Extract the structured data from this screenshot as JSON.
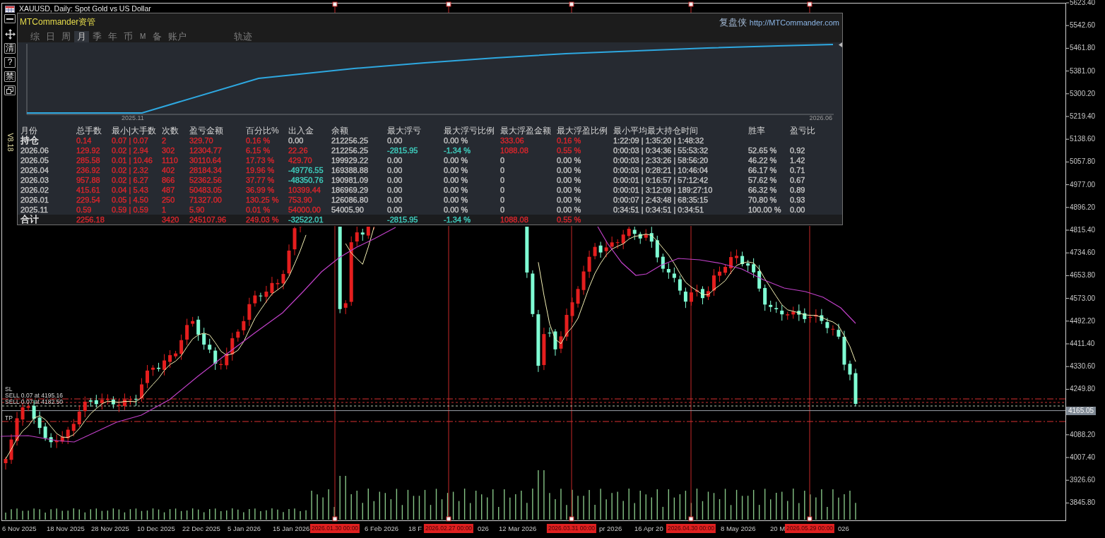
{
  "chart_window": {
    "title": "XAUUSD, Daily: Spot Gold vs US Dollar",
    "version": "V8.18"
  },
  "toolbar": [
    {
      "kind": "minimize"
    },
    {
      "kind": "move"
    },
    {
      "kind": "text",
      "label": "清"
    },
    {
      "kind": "text",
      "label": "?"
    },
    {
      "kind": "text",
      "label": "禁"
    },
    {
      "kind": "restore"
    }
  ],
  "panel": {
    "brand": "MTCommander资管",
    "brand_right": "复盘侠",
    "link": "http://MTCommander.com",
    "tabs": [
      {
        "label": "综",
        "selected": false,
        "disabled": false
      },
      {
        "label": "日",
        "selected": false,
        "disabled": false
      },
      {
        "label": "周",
        "selected": false,
        "disabled": false
      },
      {
        "label": "月",
        "selected": true,
        "disabled": false
      },
      {
        "label": "季",
        "selected": false,
        "disabled": false
      },
      {
        "label": "年",
        "selected": false,
        "disabled": false
      },
      {
        "label": "币",
        "selected": false,
        "disabled": false
      },
      {
        "label": "M",
        "selected": false,
        "disabled": true
      },
      {
        "label": "备",
        "selected": false,
        "disabled": false
      },
      {
        "label": "账户",
        "selected": false,
        "disabled": false
      },
      {
        "label": "轨迹",
        "selected": false,
        "disabled": false
      }
    ],
    "equity_chart": {
      "x_labels": [
        "2025.11",
        "2026.06"
      ]
    },
    "table": {
      "columns": [
        "月份",
        "总手数",
        "最小|大手数",
        "次数",
        "盈亏金额",
        "百分比%",
        "出入金",
        "余额",
        "最大浮亏",
        "最大浮亏比例",
        "最大浮盈金额",
        "最大浮盈比例",
        "最小平均最大持仓时间",
        "胜率",
        "盈亏比"
      ],
      "rows": [
        {
          "kind": "position",
          "cells": [
            {
              "text": "持仓",
              "color": "#e8e8e8"
            },
            {
              "text": "0.14",
              "color": "#d8262c"
            },
            {
              "text": "0.07 | 0.07",
              "color": "#d8262c"
            },
            {
              "text": "2",
              "color": "#d8262c"
            },
            {
              "text": "329.70",
              "color": "#d8262c"
            },
            {
              "text": "0.16 %",
              "color": "#d8262c"
            },
            {
              "text": "0.00",
              "color": "#c2c2c2"
            },
            {
              "text": "212256.25",
              "color": "#c2c2c2"
            },
            {
              "text": "0.00",
              "color": "#c2c2c2"
            },
            {
              "text": "0.00 %",
              "color": "#c2c2c2"
            },
            {
              "text": "333.06",
              "color": "#d8262c"
            },
            {
              "text": "0.16 %",
              "color": "#d8262c"
            },
            {
              "text": "1:22:09 | 1:35:20 | 1:48:32",
              "color": "#c2c2c2"
            }
          ]
        },
        {
          "kind": "month",
          "cells": [
            {
              "text": "2026.06",
              "color": "#c2c2c2"
            },
            {
              "text": "129.92",
              "color": "#d8262c"
            },
            {
              "text": "0.02 | 2.94",
              "color": "#d8262c"
            },
            {
              "text": "302",
              "color": "#d8262c"
            },
            {
              "text": "12304.77",
              "color": "#d8262c"
            },
            {
              "text": "6.15 %",
              "color": "#d8262c"
            },
            {
              "text": "22.26",
              "color": "#d8262c"
            },
            {
              "text": "212256.25",
              "color": "#c2c2c2"
            },
            {
              "text": "-2815.95",
              "color": "#3fcfbf"
            },
            {
              "text": "-1.34 %",
              "color": "#3fcfbf"
            },
            {
              "text": "1088.08",
              "color": "#d8262c"
            },
            {
              "text": "0.55 %",
              "color": "#d8262c"
            },
            {
              "text": "0:00:03 | 0:34:36 | 55:53:32",
              "color": "#c2c2c2"
            },
            {
              "text": "52.65 %",
              "color": "#c2c2c2"
            },
            {
              "text": "0.92",
              "color": "#c2c2c2"
            }
          ]
        },
        {
          "kind": "month",
          "cells": [
            {
              "text": "2026.05",
              "color": "#c2c2c2"
            },
            {
              "text": "285.58",
              "color": "#d8262c"
            },
            {
              "text": "0.01 | 10.46",
              "color": "#d8262c"
            },
            {
              "text": "1110",
              "color": "#d8262c"
            },
            {
              "text": "30110.64",
              "color": "#d8262c"
            },
            {
              "text": "17.73 %",
              "color": "#d8262c"
            },
            {
              "text": "429.70",
              "color": "#d8262c"
            },
            {
              "text": "199929.22",
              "color": "#c2c2c2"
            },
            {
              "text": "0.00",
              "color": "#c2c2c2"
            },
            {
              "text": "0.00 %",
              "color": "#c2c2c2"
            },
            {
              "text": "0",
              "color": "#c2c2c2"
            },
            {
              "text": "0.00 %",
              "color": "#c2c2c2"
            },
            {
              "text": "0:00:03 | 2:33:26 | 58:56:20",
              "color": "#c2c2c2"
            },
            {
              "text": "46.22 %",
              "color": "#c2c2c2"
            },
            {
              "text": "1.42",
              "color": "#c2c2c2"
            }
          ]
        },
        {
          "kind": "month",
          "cells": [
            {
              "text": "2026.04",
              "color": "#c2c2c2"
            },
            {
              "text": "236.92",
              "color": "#d8262c"
            },
            {
              "text": "0.02 | 2.32",
              "color": "#d8262c"
            },
            {
              "text": "402",
              "color": "#d8262c"
            },
            {
              "text": "28184.34",
              "color": "#d8262c"
            },
            {
              "text": "19.96 %",
              "color": "#d8262c"
            },
            {
              "text": "-49776.55",
              "color": "#3fcfbf"
            },
            {
              "text": "169388.88",
              "color": "#c2c2c2"
            },
            {
              "text": "0.00",
              "color": "#c2c2c2"
            },
            {
              "text": "0.00 %",
              "color": "#c2c2c2"
            },
            {
              "text": "0",
              "color": "#c2c2c2"
            },
            {
              "text": "0.00 %",
              "color": "#c2c2c2"
            },
            {
              "text": "0:00:03 | 0:28:21 | 10:46:04",
              "color": "#c2c2c2"
            },
            {
              "text": "66.17 %",
              "color": "#c2c2c2"
            },
            {
              "text": "0.71",
              "color": "#c2c2c2"
            }
          ]
        },
        {
          "kind": "month",
          "cells": [
            {
              "text": "2026.03",
              "color": "#c2c2c2"
            },
            {
              "text": "957.88",
              "color": "#d8262c"
            },
            {
              "text": "0.02 | 6.27",
              "color": "#d8262c"
            },
            {
              "text": "866",
              "color": "#d8262c"
            },
            {
              "text": "52362.56",
              "color": "#d8262c"
            },
            {
              "text": "37.77 %",
              "color": "#d8262c"
            },
            {
              "text": "-48350.76",
              "color": "#3fcfbf"
            },
            {
              "text": "190981.09",
              "color": "#c2c2c2"
            },
            {
              "text": "0.00",
              "color": "#c2c2c2"
            },
            {
              "text": "0.00 %",
              "color": "#c2c2c2"
            },
            {
              "text": "0",
              "color": "#c2c2c2"
            },
            {
              "text": "0.00 %",
              "color": "#c2c2c2"
            },
            {
              "text": "0:00:01 | 0:16:57 | 57:12:42",
              "color": "#c2c2c2"
            },
            {
              "text": "57.62 %",
              "color": "#c2c2c2"
            },
            {
              "text": "0.67",
              "color": "#c2c2c2"
            }
          ]
        },
        {
          "kind": "month",
          "cells": [
            {
              "text": "2026.02",
              "color": "#c2c2c2"
            },
            {
              "text": "415.61",
              "color": "#d8262c"
            },
            {
              "text": "0.04 | 5.43",
              "color": "#d8262c"
            },
            {
              "text": "487",
              "color": "#d8262c"
            },
            {
              "text": "50483.05",
              "color": "#d8262c"
            },
            {
              "text": "36.99 %",
              "color": "#d8262c"
            },
            {
              "text": "10399.44",
              "color": "#d8262c"
            },
            {
              "text": "186969.29",
              "color": "#c2c2c2"
            },
            {
              "text": "0.00",
              "color": "#c2c2c2"
            },
            {
              "text": "0.00 %",
              "color": "#c2c2c2"
            },
            {
              "text": "0",
              "color": "#c2c2c2"
            },
            {
              "text": "0.00 %",
              "color": "#c2c2c2"
            },
            {
              "text": "0:00:01 | 3:12:09 | 189:27:10",
              "color": "#c2c2c2"
            },
            {
              "text": "66.32 %",
              "color": "#c2c2c2"
            },
            {
              "text": "0.89",
              "color": "#c2c2c2"
            }
          ]
        },
        {
          "kind": "month",
          "cells": [
            {
              "text": "2026.01",
              "color": "#c2c2c2"
            },
            {
              "text": "229.54",
              "color": "#d8262c"
            },
            {
              "text": "0.05 | 4.50",
              "color": "#d8262c"
            },
            {
              "text": "250",
              "color": "#d8262c"
            },
            {
              "text": "71327.00",
              "color": "#d8262c"
            },
            {
              "text": "130.25 %",
              "color": "#d8262c"
            },
            {
              "text": "753.90",
              "color": "#d8262c"
            },
            {
              "text": "126086.80",
              "color": "#c2c2c2"
            },
            {
              "text": "0.00",
              "color": "#c2c2c2"
            },
            {
              "text": "0.00 %",
              "color": "#c2c2c2"
            },
            {
              "text": "0",
              "color": "#c2c2c2"
            },
            {
              "text": "0.00 %",
              "color": "#c2c2c2"
            },
            {
              "text": "0:00:07 | 2:43:48 | 68:35:15",
              "color": "#c2c2c2"
            },
            {
              "text": "70.80 %",
              "color": "#c2c2c2"
            },
            {
              "text": "0.93",
              "color": "#c2c2c2"
            }
          ]
        },
        {
          "kind": "month",
          "cells": [
            {
              "text": "2025.11",
              "color": "#c2c2c2"
            },
            {
              "text": "0.59",
              "color": "#d8262c"
            },
            {
              "text": "0.59 | 0.59",
              "color": "#d8262c"
            },
            {
              "text": "1",
              "color": "#d8262c"
            },
            {
              "text": "5.90",
              "color": "#d8262c"
            },
            {
              "text": "0.01 %",
              "color": "#d8262c"
            },
            {
              "text": "54000.00",
              "color": "#d8262c"
            },
            {
              "text": "54005.90",
              "color": "#c2c2c2"
            },
            {
              "text": "0.00",
              "color": "#c2c2c2"
            },
            {
              "text": "0.00 %",
              "color": "#c2c2c2"
            },
            {
              "text": "0",
              "color": "#c2c2c2"
            },
            {
              "text": "0.00 %",
              "color": "#c2c2c2"
            },
            {
              "text": "0:34:51 | 0:34:51 | 0:34:51",
              "color": "#c2c2c2"
            },
            {
              "text": "100.00 %",
              "color": "#c2c2c2"
            },
            {
              "text": "0.00",
              "color": "#c2c2c2"
            }
          ]
        },
        {
          "kind": "total",
          "cells": [
            {
              "text": "合计",
              "color": "#e8e8e8"
            },
            {
              "text": "2256.18",
              "color": "#d8262c"
            },
            null,
            {
              "text": "3420",
              "color": "#d8262c"
            },
            {
              "text": "245107.96",
              "color": "#d8262c"
            },
            {
              "text": "249.03 %",
              "color": "#d8262c"
            },
            {
              "text": "-32522.01",
              "color": "#3fcfbf"
            },
            null,
            {
              "text": "-2815.95",
              "color": "#3fcfbf"
            },
            {
              "text": "-1.34 %",
              "color": "#3fcfbf"
            },
            {
              "text": "1088.08",
              "color": "#d8262c"
            },
            {
              "text": "0.55 %",
              "color": "#d8262c"
            }
          ]
        }
      ]
    }
  },
  "price_axis": {
    "labels": [
      {
        "kind": "tick",
        "text": "5623.40"
      },
      {
        "kind": "tick",
        "text": "5542.60"
      },
      {
        "kind": "tick",
        "text": "5461.80"
      },
      {
        "kind": "tick",
        "text": "5381.00"
      },
      {
        "kind": "tick",
        "text": "5300.20"
      },
      {
        "kind": "tick",
        "text": "5219.40"
      },
      {
        "kind": "tick",
        "text": "5138.60"
      },
      {
        "kind": "tick",
        "text": "5057.80"
      },
      {
        "kind": "tick",
        "text": "4977.00"
      },
      {
        "kind": "tick",
        "text": "4896.20"
      },
      {
        "kind": "tick",
        "text": "4815.40"
      },
      {
        "kind": "tick",
        "text": "4734.60"
      },
      {
        "kind": "tick",
        "text": "4653.80"
      },
      {
        "kind": "tick",
        "text": "4573.00"
      },
      {
        "kind": "tick",
        "text": "4492.20"
      },
      {
        "kind": "tick",
        "text": "4411.40"
      },
      {
        "kind": "tick",
        "text": "4330.60"
      },
      {
        "kind": "tick",
        "text": "4249.80"
      },
      {
        "kind": "current",
        "text": "4165.05"
      },
      {
        "kind": "tick",
        "text": "4088.20"
      },
      {
        "kind": "tick",
        "text": "4007.40"
      },
      {
        "kind": "tick",
        "text": "3926.60"
      },
      {
        "kind": "tick",
        "text": "3845.80"
      }
    ]
  },
  "trade_lines": [
    {
      "kind": "sl",
      "label": "SL"
    },
    {
      "kind": "sell",
      "label": "SELL 0.07 at 4195.16"
    },
    {
      "kind": "sell",
      "label": "SELL 0.07 at 4182.50"
    },
    {
      "kind": "tp",
      "label": "TP"
    }
  ],
  "date_axis": {
    "labels": [
      {
        "kind": "date",
        "text": "6 Nov 2025"
      },
      {
        "kind": "date",
        "text": "18 Nov 2025"
      },
      {
        "kind": "date",
        "text": "28 Nov 2025"
      },
      {
        "kind": "date",
        "text": "10 Dec 2025"
      },
      {
        "kind": "date",
        "text": "22 Dec 2025"
      },
      {
        "kind": "date",
        "text": "5 Jan 2026"
      },
      {
        "kind": "date",
        "text": "15 Jan 2026"
      },
      {
        "kind": "marker",
        "text": "2026.01.30 00:00"
      },
      {
        "kind": "date",
        "text": "6 Feb 2026"
      },
      {
        "kind": "date",
        "text": "18 F"
      },
      {
        "kind": "marker",
        "text": "2026.02.27 00:00"
      },
      {
        "kind": "date",
        "text": "026"
      },
      {
        "kind": "date",
        "text": "12 Mar 2026"
      },
      {
        "kind": "marker",
        "text": "2026.03.31 00:00"
      },
      {
        "kind": "date",
        "text": "pr 2026"
      },
      {
        "kind": "date",
        "text": "16 Apr 20"
      },
      {
        "kind": "marker",
        "text": "2026.04.30 00:00"
      },
      {
        "kind": "date",
        "text": "8 May 2026"
      },
      {
        "kind": "date",
        "text": "20 M"
      },
      {
        "kind": "marker",
        "text": "2026.05.29 00:00"
      },
      {
        "kind": "date",
        "text": "026"
      }
    ]
  }
}
